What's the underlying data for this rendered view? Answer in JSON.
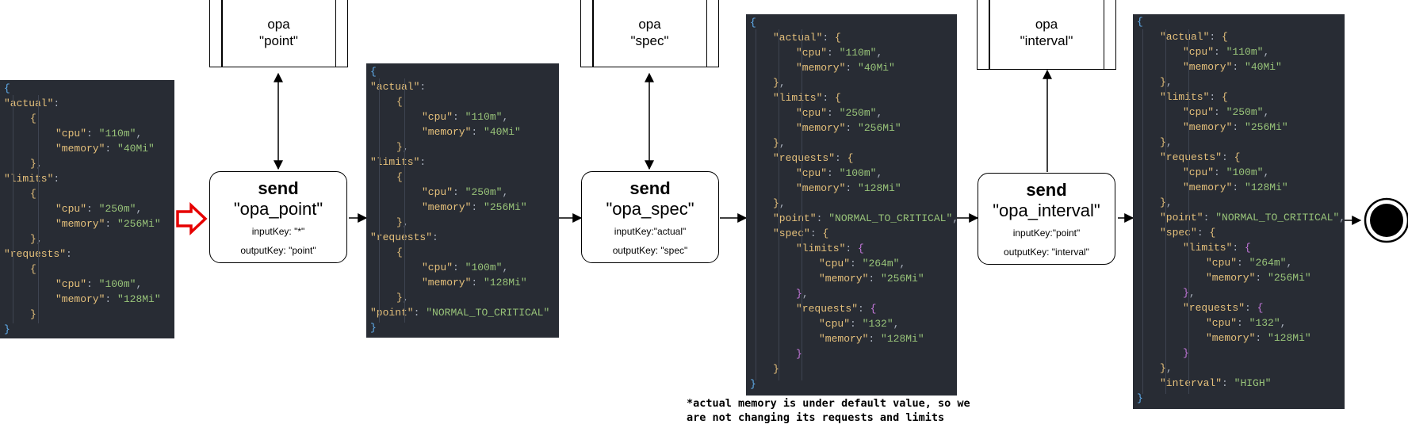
{
  "opa_boxes": [
    {
      "line1": "opa",
      "line2": "\"point\""
    },
    {
      "line1": "opa",
      "line2": "\"spec\""
    },
    {
      "line1": "opa",
      "line2": "\"interval\""
    }
  ],
  "send_nodes": [
    {
      "title": "send",
      "name": "\"opa_point\"",
      "input": "inputKey: \"*\"",
      "output": "outputKey: \"point\""
    },
    {
      "title": "send",
      "name": "\"opa_spec\"",
      "input": "inputKey:\"actual\"",
      "output": "outputKey: \"spec\""
    },
    {
      "title": "send",
      "name": "\"opa_interval\"",
      "input": "inputKey:\"point\"",
      "output": "outputKey: \"interval\""
    }
  ],
  "json_blocks": [
    [
      "{",
      "\"actual\":",
      "{",
      "\"cpu\": \"110m\",",
      "\"memory\": \"40Mi\"",
      "},",
      "\"limits\":",
      "{",
      "\"cpu\": \"250m\",",
      "\"memory\": \"256Mi\"",
      "},",
      "\"requests\":",
      "{",
      "\"cpu\": \"100m\",",
      "\"memory\": \"128Mi\"",
      "}",
      "}"
    ],
    [
      "{",
      "\"actual\":",
      "{",
      "\"cpu\": \"110m\",",
      "\"memory\": \"40Mi\"",
      "},",
      "\"limits\":",
      "{",
      "\"cpu\": \"250m\",",
      "\"memory\": \"256Mi\"",
      "},",
      "\"requests\":",
      "{",
      "\"cpu\": \"100m\",",
      "\"memory\": \"128Mi\"",
      "},",
      "\"point\": \"NORMAL_TO_CRITICAL\"",
      "}"
    ],
    [
      "{",
      "\"actual\": {",
      "\"cpu\": \"110m\",",
      "\"memory\": \"40Mi\"",
      "},",
      "\"limits\": {",
      "\"cpu\": \"250m\",",
      "\"memory\": \"256Mi\"",
      "},",
      "\"requests\": {",
      "\"cpu\": \"100m\",",
      "\"memory\": \"128Mi\"",
      "},",
      "\"point\": \"NORMAL_TO_CRITICAL\",",
      "\"spec\": {",
      "\"limits\": {",
      "\"cpu\": \"264m\",",
      "\"memory\": \"256Mi\"",
      "},",
      "\"requests\": {",
      "\"cpu\": \"132\",",
      "\"memory\": \"128Mi\"",
      "}",
      "}",
      "}"
    ],
    [
      "{",
      "\"actual\": {",
      "\"cpu\": \"110m\",",
      "\"memory\": \"40Mi\"",
      "},",
      "\"limits\": {",
      "\"cpu\": \"250m\",",
      "\"memory\": \"256Mi\"",
      "},",
      "\"requests\": {",
      "\"cpu\": \"100m\",",
      "\"memory\": \"128Mi\"",
      "},",
      "\"point\": \"NORMAL_TO_CRITICAL\",",
      "\"spec\": {",
      "\"limits\": {",
      "\"cpu\": \"264m\",",
      "\"memory\": \"256Mi\"",
      "},",
      "\"requests\": {",
      "\"cpu\": \"132\",",
      "\"memory\": \"128Mi\"",
      "}",
      "},",
      "\"interval\": \"HIGH\"",
      "}"
    ]
  ],
  "note": {
    "line1": "*actual memory is under default value, so we",
    "line2": "are not changing its requests and limits"
  },
  "colors": {
    "json_bg": "#282c34",
    "key": "#e5c07b",
    "string": "#98c379",
    "brace_outer": "#61afef",
    "start_arrow": "#e60000"
  }
}
